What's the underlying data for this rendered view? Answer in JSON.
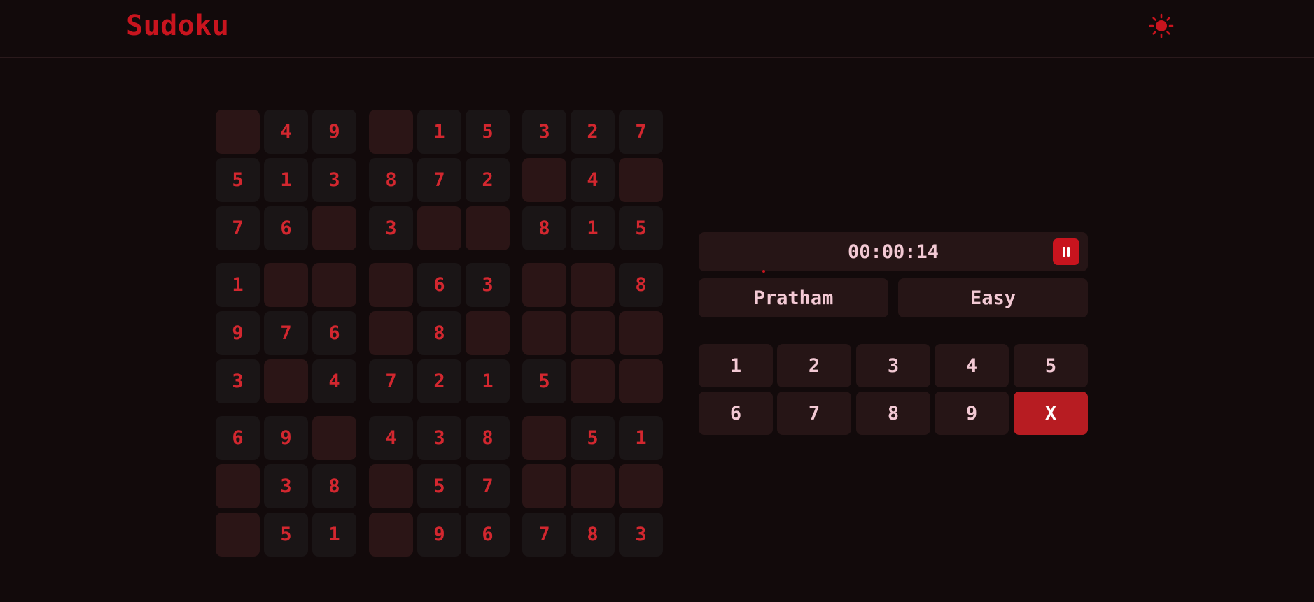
{
  "header": {
    "title": "Sudoku",
    "theme_icon": "sun-icon"
  },
  "board": [
    [
      "",
      "4",
      "9",
      "",
      "1",
      "5",
      "3",
      "2",
      "7"
    ],
    [
      "5",
      "1",
      "3",
      "8",
      "7",
      "2",
      "",
      "4",
      ""
    ],
    [
      "7",
      "6",
      "",
      "3",
      "",
      "",
      "8",
      "1",
      "5"
    ],
    [
      "1",
      "",
      "",
      "",
      "6",
      "3",
      "",
      "",
      "8"
    ],
    [
      "9",
      "7",
      "6",
      "",
      "8",
      "",
      "",
      "",
      ""
    ],
    [
      "3",
      "",
      "4",
      "7",
      "2",
      "1",
      "5",
      "",
      ""
    ],
    [
      "6",
      "9",
      "",
      "4",
      "3",
      "8",
      "",
      "5",
      "1"
    ],
    [
      "",
      "3",
      "8",
      "",
      "5",
      "7",
      "",
      "",
      ""
    ],
    [
      "",
      "5",
      "1",
      "",
      "9",
      "6",
      "7",
      "8",
      "3"
    ]
  ],
  "timer": {
    "value": "00:00:14",
    "pause_icon": "pause-icon"
  },
  "player": {
    "name": "Pratham"
  },
  "difficulty": {
    "label": "Easy"
  },
  "numpad": {
    "keys": [
      "1",
      "2",
      "3",
      "4",
      "5",
      "6",
      "7",
      "8",
      "9"
    ],
    "clear_label": "X"
  },
  "colors": {
    "accent": "#c8141e",
    "background": "#120a0b",
    "cell_filled": "#1a1516",
    "cell_empty": "#2b1516",
    "digit": "#d3272f",
    "panel": "#261516",
    "panel_text": "#f3c9d4"
  }
}
